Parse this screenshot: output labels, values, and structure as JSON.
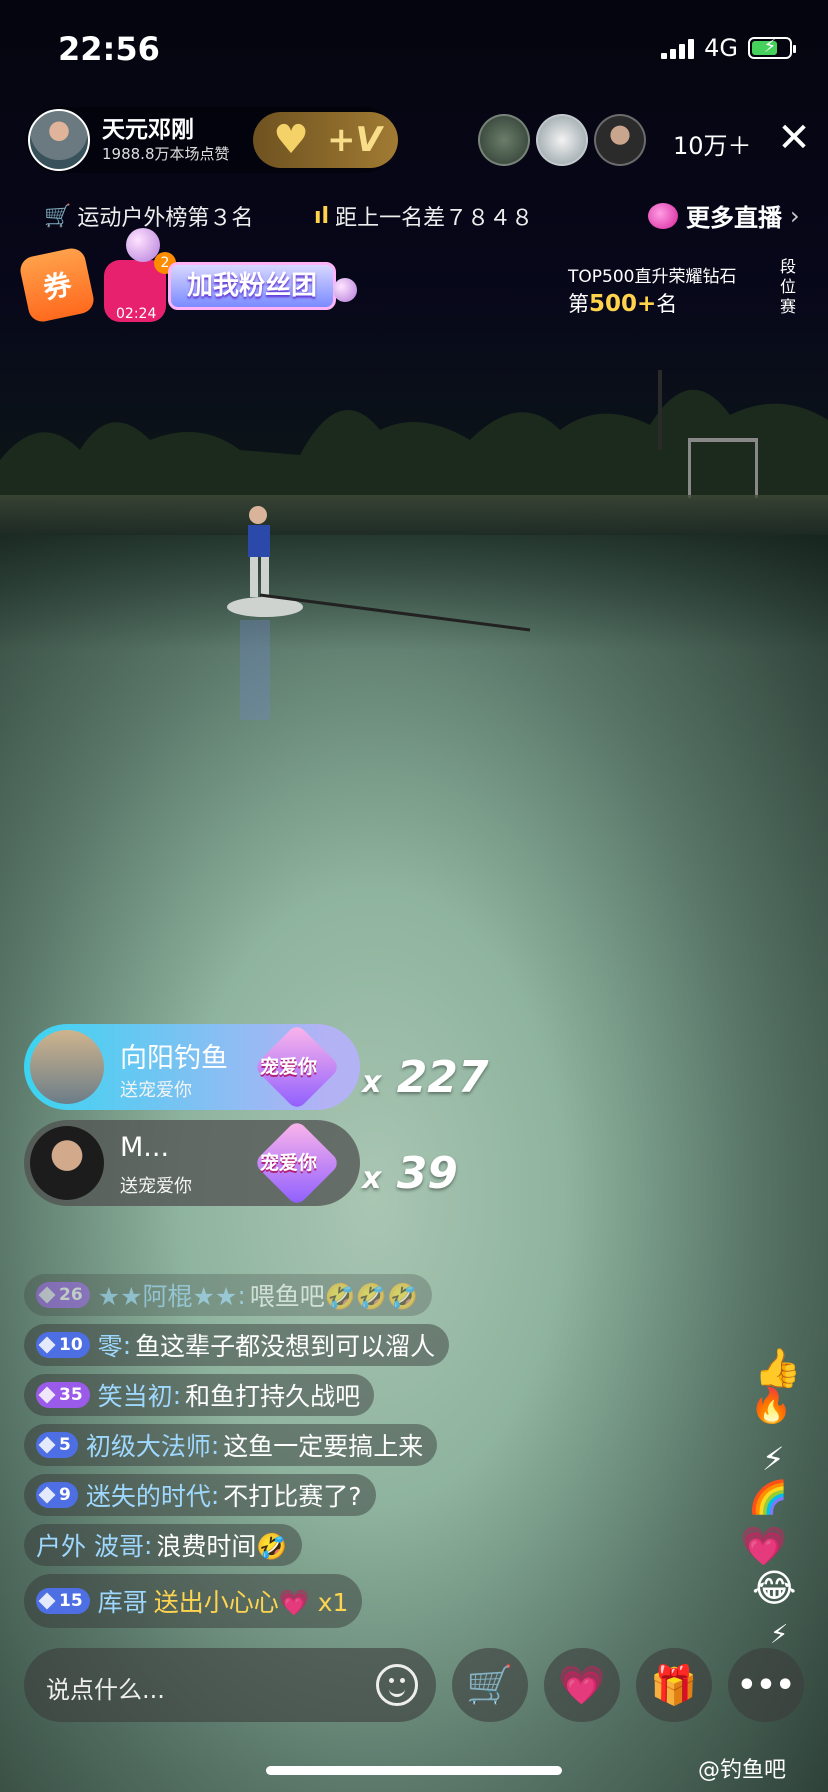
{
  "status": {
    "time": "22:56",
    "network": "4G"
  },
  "host": {
    "name": "天元邓刚",
    "likes": "1988.8万本场点赞"
  },
  "viewers": {
    "count": "10万＋"
  },
  "rank": {
    "category": "运动户外榜第３名",
    "gap": "距上一名差７８４８",
    "more_live": "更多直播",
    "top500_title": "TOP500直升荣耀钻石",
    "top500_prefix": "第",
    "top500_value": "500+",
    "top500_suffix": "名",
    "duanwei": "段位赛"
  },
  "coupon_label": "券",
  "fans": {
    "count": "2",
    "timer": "02:24",
    "label": "加我粉丝团"
  },
  "gifts": [
    {
      "name": "向阳钓鱼",
      "desc": "送宠爱你",
      "icon_text": "宠爱你",
      "combo_x": "x",
      "combo": "227"
    },
    {
      "name": "M...",
      "desc": "送宠爱你",
      "icon_text": "宠爱你",
      "combo_x": "x",
      "combo": "39"
    }
  ],
  "chat": [
    {
      "level": "26",
      "level_color": "purple",
      "user": "★★阿棍★★",
      "sep": ":",
      "text": "喂鱼吧🤣🤣🤣"
    },
    {
      "level": "10",
      "level_color": "blue",
      "user": "零",
      "sep": ":",
      "text": "鱼这辈子都没想到可以溜人"
    },
    {
      "level": "35",
      "level_color": "purple",
      "user": "笑当初",
      "sep": ":",
      "text": "和鱼打持久战吧"
    },
    {
      "level": "5",
      "level_color": "blue",
      "user": "初级大法师",
      "sep": ":",
      "text": "这鱼一定要搞上来"
    },
    {
      "level": "9",
      "level_color": "blue",
      "user": "迷失的时代",
      "sep": ":",
      "text": "不打比赛了?"
    },
    {
      "level": "",
      "level_color": "",
      "user": "户外 波哥",
      "sep": ":",
      "text": "浪费时间🤣"
    },
    {
      "level": "15",
      "level_color": "blue",
      "user": "库哥",
      "sep": "",
      "text": "送出小心心💗 x1"
    }
  ],
  "input": {
    "placeholder": "说点什么..."
  },
  "watermark": "@钓鱼吧",
  "icons": {
    "close": "close-icon",
    "cart": "shopping-cart-icon",
    "heart": "heart-gift-icon",
    "gift": "gift-box-icon",
    "more": "more-icon",
    "emoji": "emoji-icon"
  },
  "colors": {
    "accent_gold": "#ffd34a",
    "chat_user": "#9fd8ff",
    "gift_text": "#ffd44f"
  }
}
